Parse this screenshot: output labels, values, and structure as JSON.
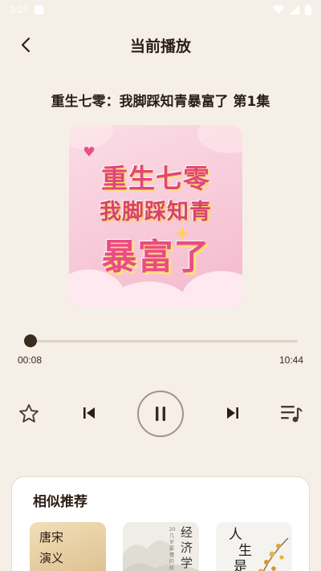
{
  "status_bar": {
    "time": "3:27"
  },
  "header": {
    "title": "当前播放"
  },
  "track": {
    "title": "重生七零：我脚踩知青暴富了 第1集"
  },
  "cover": {
    "line1": "重生七零",
    "line2": "我脚踩知青",
    "line3": "暴富了"
  },
  "player": {
    "current_time": "00:08",
    "total_time": "10:44",
    "progress_fraction": 0.012,
    "is_playing": true
  },
  "recommend": {
    "title": "相似推荐",
    "items": [
      {
        "cover_text": "唐宋演义"
      },
      {
        "cover_text": "经济学",
        "cover_subtext": "20几岁要懂的经济学知识"
      },
      {
        "cover_text": "人生是"
      }
    ]
  },
  "icons": {
    "back": "chevron-left-icon",
    "favorite": "star-outline-icon",
    "previous": "skip-previous-icon",
    "pause": "pause-icon",
    "next": "skip-next-icon",
    "playlist": "playlist-music-icon"
  },
  "colors": {
    "background": "#f6efe7",
    "text": "#3a2a20",
    "accent": "#3a2a20"
  }
}
